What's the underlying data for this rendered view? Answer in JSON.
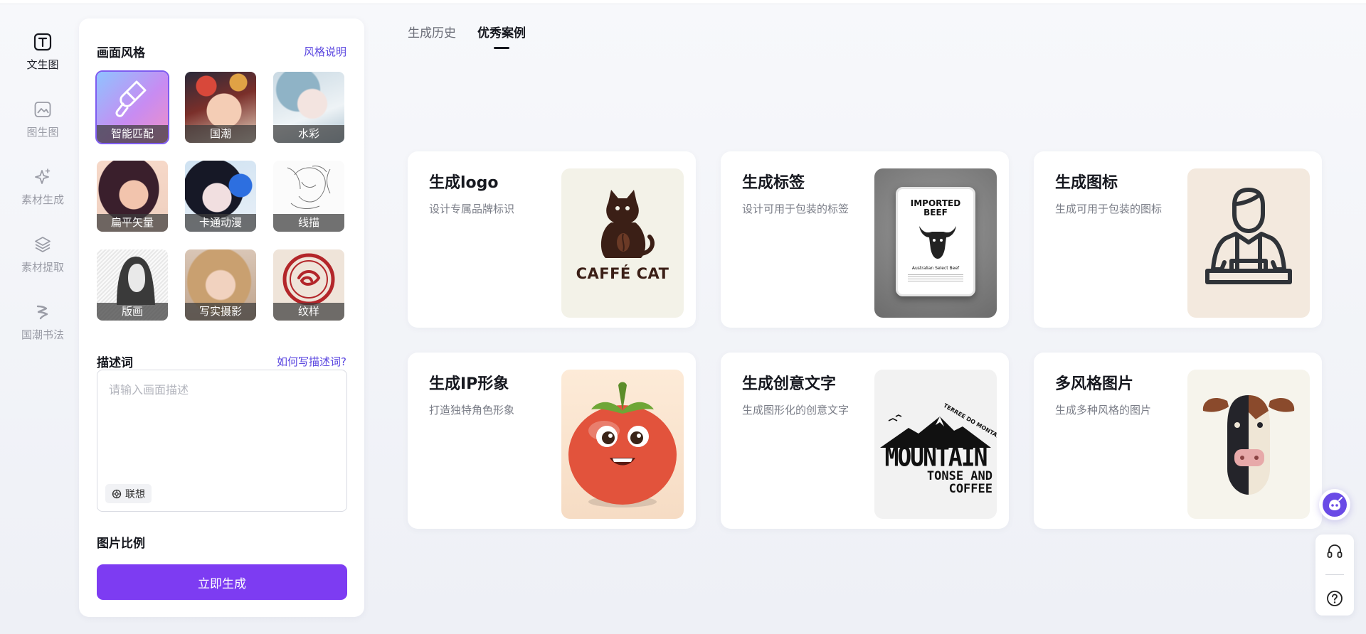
{
  "rail": {
    "items": [
      {
        "label": "文生图",
        "icon": "text-to-image-icon",
        "active": true
      },
      {
        "label": "图生图",
        "icon": "image-to-image-icon",
        "active": false
      },
      {
        "label": "素材生成",
        "icon": "sparkle-icon",
        "active": false
      },
      {
        "label": "素材提取",
        "icon": "layers-icon",
        "active": false
      },
      {
        "label": "国潮书法",
        "icon": "calligraphy-icon",
        "active": false
      }
    ]
  },
  "panel": {
    "style_title": "画面风格",
    "style_link": "风格说明",
    "styles": [
      {
        "label": "智能匹配",
        "selected": true
      },
      {
        "label": "国潮",
        "selected": false
      },
      {
        "label": "水彩",
        "selected": false
      },
      {
        "label": "扁平矢量",
        "selected": false
      },
      {
        "label": "卡通动漫",
        "selected": false
      },
      {
        "label": "线描",
        "selected": false
      },
      {
        "label": "版画",
        "selected": false
      },
      {
        "label": "写实摄影",
        "selected": false
      },
      {
        "label": "纹样",
        "selected": false
      }
    ],
    "desc_title": "描述词",
    "desc_link": "如何写描述词?",
    "desc_placeholder": "请输入画面描述",
    "assoc_label": "联想",
    "ratio_title": "图片比例",
    "generate_label": "立即生成"
  },
  "tabs": [
    {
      "label": "生成历史",
      "active": false
    },
    {
      "label": "优秀案例",
      "active": true
    }
  ],
  "cards": [
    {
      "title": "生成logo",
      "desc": "设计专属品牌标识",
      "thumb_text": "CAFFÉ CAT"
    },
    {
      "title": "生成标签",
      "desc": "设计可用于包装的标签",
      "thumb_text": "IMPORTED BEEF",
      "thumb_sub": "Australian Select Beef"
    },
    {
      "title": "生成图标",
      "desc": "生成可用于包装的图标"
    },
    {
      "title": "生成IP形象",
      "desc": "打造独特角色形象"
    },
    {
      "title": "生成创意文字",
      "desc": "生成图形化的创意文字",
      "thumb_text": "MOUNTAIN",
      "thumb_sub1": "TONSE AND",
      "thumb_sub2": "COFFEE",
      "thumb_arc": "TERREE DO MONTAIN"
    },
    {
      "title": "多风格图片",
      "desc": "生成多种风格的图片"
    }
  ],
  "colors": {
    "accent": "#7d3cf2",
    "link": "#5b47e0",
    "selected_outline": "#7e5cf0"
  }
}
